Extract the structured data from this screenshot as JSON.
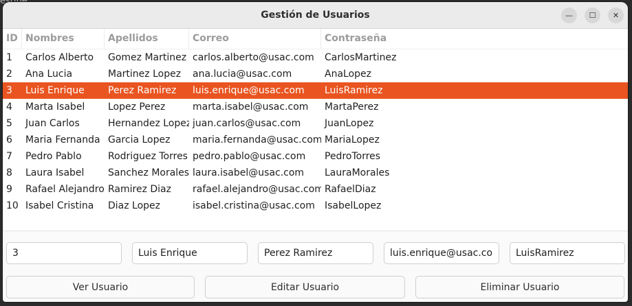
{
  "background_text": "estine",
  "window": {
    "title": "Gestión de Usuarios",
    "controls": {
      "minimize": "—",
      "maximize": "☐",
      "close": "✕"
    }
  },
  "table": {
    "headers": [
      "ID",
      "Nombres",
      "Apellidos",
      "Correo",
      "Contraseña"
    ],
    "selected_row_index": 2,
    "selection_color": "#e95420",
    "rows": [
      [
        "1",
        "Carlos Alberto",
        "Gomez Martinez",
        "carlos.alberto@usac.com",
        "CarlosMartinez"
      ],
      [
        "2",
        "Ana Lucia",
        "Martinez Lopez",
        "ana.lucia@usac.com",
        "AnaLopez"
      ],
      [
        "3",
        "Luis Enrique",
        "Perez Ramirez",
        "luis.enrique@usac.com",
        "LuisRamirez"
      ],
      [
        "4",
        "Marta Isabel",
        "Lopez Perez",
        "marta.isabel@usac.com",
        "MartaPerez"
      ],
      [
        "5",
        "Juan Carlos",
        "Hernandez Lopez",
        "juan.carlos@usac.com",
        "JuanLopez"
      ],
      [
        "6",
        "Maria Fernanda",
        "Garcia Lopez",
        "maria.fernanda@usac.com",
        "MariaLopez"
      ],
      [
        "7",
        "Pedro Pablo",
        "Rodriguez Torres",
        "pedro.pablo@usac.com",
        "PedroTorres"
      ],
      [
        "8",
        "Laura Isabel",
        "Sanchez Morales",
        "laura.isabel@usac.com",
        "LauraMorales"
      ],
      [
        "9",
        "Rafael Alejandro",
        "Ramirez Diaz",
        "rafael.alejandro@usac.com",
        "RafaelDiaz"
      ],
      [
        "10",
        "Isabel Cristina",
        "Diaz Lopez",
        "isabel.cristina@usac.com",
        "IsabelLopez"
      ]
    ]
  },
  "form": {
    "id": "3",
    "nombres": "Luis Enrique",
    "apellidos": "Perez Ramirez",
    "correo": "luis.enrique@usac.com",
    "contrasena": "LuisRamirez"
  },
  "buttons": {
    "ver": "Ver Usuario",
    "editar": "Editar Usuario",
    "eliminar": "Eliminar Usuario"
  }
}
